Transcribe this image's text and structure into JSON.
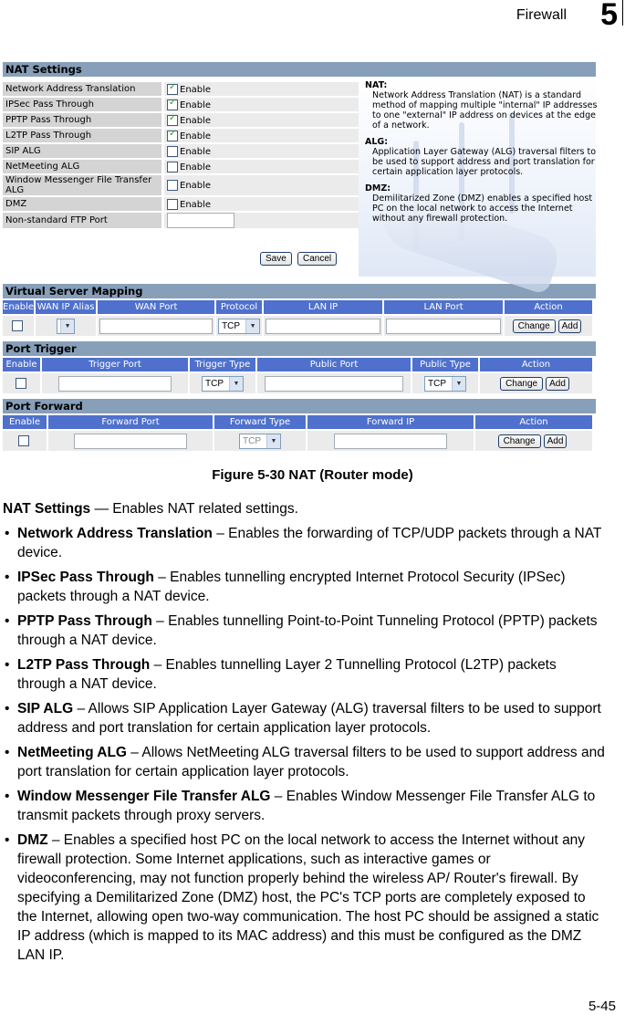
{
  "page_header": {
    "section": "Firewall",
    "chapter": "5"
  },
  "nat_settings": {
    "title": "NAT Settings",
    "rows": [
      {
        "label": "Network Address Translation",
        "type": "checkbox",
        "checked": true,
        "option": "Enable"
      },
      {
        "label": "IPSec Pass Through",
        "type": "checkbox",
        "checked": true,
        "option": "Enable"
      },
      {
        "label": "PPTP Pass Through",
        "type": "checkbox",
        "checked": true,
        "option": "Enable"
      },
      {
        "label": "L2TP Pass Through",
        "type": "checkbox",
        "checked": true,
        "option": "Enable"
      },
      {
        "label": "SIP ALG",
        "type": "checkbox",
        "checked": false,
        "option": "Enable"
      },
      {
        "label": "NetMeeting ALG",
        "type": "checkbox",
        "checked": false,
        "option": "Enable"
      },
      {
        "label": "Window Messenger File Transfer ALG",
        "type": "checkbox",
        "checked": false,
        "option": "Enable"
      },
      {
        "label": "DMZ",
        "type": "checkbox",
        "checked": false,
        "option": "Enable"
      },
      {
        "label": "Non-standard FTP Port",
        "type": "text",
        "value": ""
      }
    ],
    "help": [
      {
        "heading": "NAT:",
        "text": "Network Address Translation (NAT) is a standard method of mapping multiple \"internal\" IP addresses to one \"external\" IP address on devices at the edge of a network."
      },
      {
        "heading": "ALG:",
        "text": "Application Layer Gateway (ALG) traversal filters to be used to support address and port translation for certain application layer protocols."
      },
      {
        "heading": "DMZ:",
        "text": "Demilitarized Zone (DMZ) enables a specified host PC on the local network to access the Internet without any firewall protection."
      }
    ],
    "save_label": "Save",
    "cancel_label": "Cancel"
  },
  "virtual_server": {
    "title": "Virtual Server Mapping",
    "columns": [
      "Enable",
      "WAN IP Alias",
      "WAN Port",
      "Protocol",
      "LAN IP",
      "LAN Port",
      "Action"
    ],
    "row": {
      "enabled": false,
      "wan_ip_alias": "",
      "wan_port": "",
      "protocol": "TCP",
      "lan_ip": "",
      "lan_port": ""
    },
    "change_label": "Change",
    "add_label": "Add"
  },
  "port_trigger": {
    "title": "Port Trigger",
    "columns": [
      "Enable",
      "Trigger Port",
      "Trigger Type",
      "Public Port",
      "Public Type",
      "Action"
    ],
    "row": {
      "enabled": false,
      "trigger_port": "",
      "trigger_type": "TCP",
      "public_port": "",
      "public_type": "TCP"
    },
    "change_label": "Change",
    "add_label": "Add"
  },
  "port_forward": {
    "title": "Port Forward",
    "columns": [
      "Enable",
      "Forward Port",
      "Forward Type",
      "Forward IP",
      "Action"
    ],
    "row": {
      "enabled": false,
      "forward_port": "",
      "forward_type": "TCP",
      "forward_ip": ""
    },
    "change_label": "Change",
    "add_label": "Add"
  },
  "caption": "Figure 5-30  NAT (Router mode)",
  "intro": {
    "term": "NAT Settings",
    "text": " — Enables NAT related settings."
  },
  "bullets": [
    {
      "term": "Network Address Translation",
      "text": " – Enables the forwarding of TCP/UDP packets through a NAT device."
    },
    {
      "term": "IPSec Pass Through",
      "text": " – Enables tunnelling encrypted Internet Protocol Security (IPSec) packets through a NAT device."
    },
    {
      "term": "PPTP Pass Through",
      "text": " – Enables tunnelling Point-to-Point Tunneling Protocol (PPTP) packets through a NAT device."
    },
    {
      "term": "L2TP Pass Through",
      "text": " – Enables tunnelling Layer 2 Tunnelling Protocol (L2TP) packets through a NAT device."
    },
    {
      "term": "SIP ALG",
      "text": " – Allows SIP Application Layer Gateway (ALG) traversal filters to be used to support address and port translation for certain application layer protocols."
    },
    {
      "term": "NetMeeting ALG",
      "text": " – Allows NetMeeting ALG traversal filters to be used to support address and port translation for certain application layer protocols."
    },
    {
      "term": "Window Messenger File Transfer ALG",
      "text": " – Enables Window Messenger File Transfer ALG to transmit packets through proxy servers."
    },
    {
      "term": "DMZ",
      "text": " – Enables a specified host PC on the local network to access the Internet without any firewall protection. Some Internet applications, such as interactive games or videoconferencing, may not function properly behind the wireless AP/ Router's firewall. By specifying a Demilitarized Zone (DMZ) host, the PC's TCP ports are completely exposed to the Internet, allowing open two-way communication. The host PC should be assigned a static IP address (which is mapped to its MAC address) and this must be configured as the DMZ LAN IP."
    }
  ],
  "page_number": "5-45"
}
